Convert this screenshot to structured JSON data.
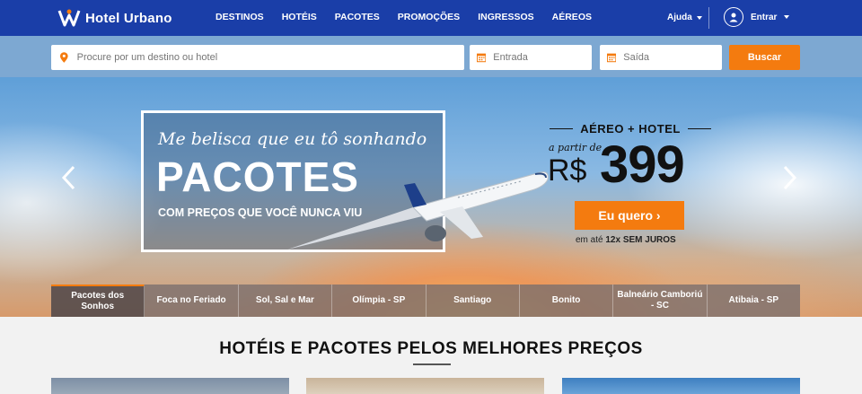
{
  "brand": {
    "name": "Hotel Urbano"
  },
  "nav": {
    "items": [
      "DESTINOS",
      "HOTÉIS",
      "PACOTES",
      "PROMOÇÕES",
      "INGRESSOS",
      "AÉREOS"
    ],
    "help": "Ajuda",
    "login": "Entrar"
  },
  "search": {
    "destination_placeholder": "Procure por um destino ou hotel",
    "checkin_placeholder": "Entrada",
    "checkout_placeholder": "Saída",
    "button": "Buscar"
  },
  "hero": {
    "script": "Me belisca que eu tô sonhando",
    "headline": "PACOTES",
    "subline": "COM PREÇOS QUE VOCÊ NUNCA VIU",
    "offer_title": "AÉREO + HOTEL",
    "offer_from": "a partir de",
    "currency": "R$",
    "price": "399",
    "cta": "Eu quero ›",
    "installments_prefix": "em até ",
    "installments_bold": "12x SEM JUROS"
  },
  "tabs": [
    "Pacotes dos Sonhos",
    "Foca no Feriado",
    "Sol, Sal e Mar",
    "Olímpia - SP",
    "Santiago",
    "Bonito",
    "Balneário Camboriú - SC",
    "Atibaia - SP"
  ],
  "section": {
    "title": "HOTÉIS E PACOTES PELOS MELHORES PREÇOS"
  },
  "colors": {
    "nav_bg": "#1a3ea8",
    "accent": "#f47b0f"
  }
}
